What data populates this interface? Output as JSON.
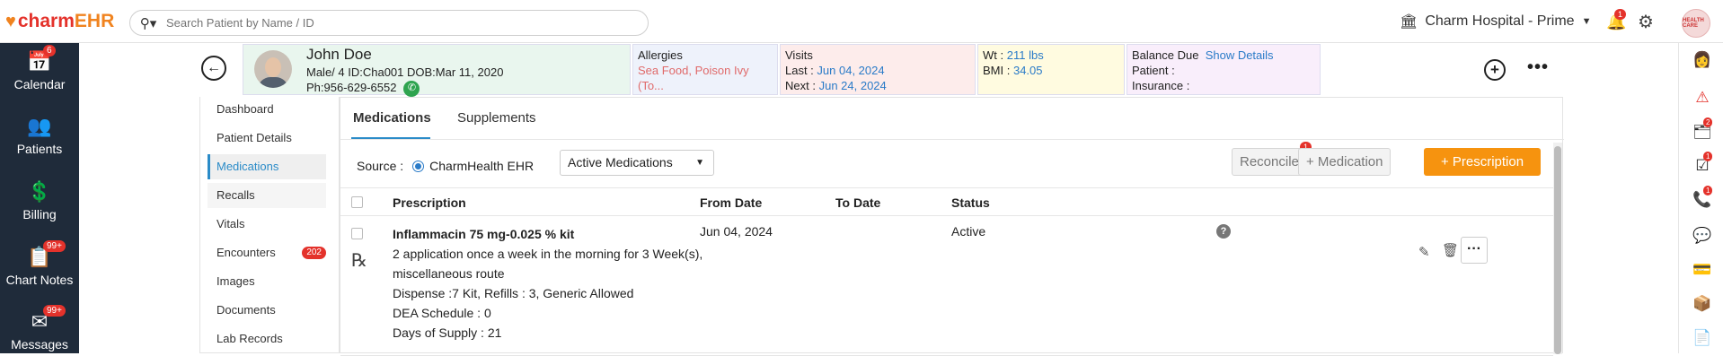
{
  "app": {
    "logo_charm": "charm",
    "logo_ehr": "EHR"
  },
  "search": {
    "placeholder": "Search Patient by Name / ID"
  },
  "header": {
    "hospital": "Charm Hospital - Prime",
    "bell_count": "1",
    "avatar_text": "HEALTH CARE"
  },
  "sidenav": [
    {
      "label": "Calendar",
      "badge": "6",
      "icon": "calendar-icon",
      "glyph": "📅"
    },
    {
      "label": "Patients",
      "badge": "",
      "icon": "patients-icon",
      "glyph": "👥"
    },
    {
      "label": "Billing",
      "badge": "",
      "icon": "billing-icon",
      "glyph": "💲"
    },
    {
      "label": "Chart Notes",
      "badge": "99+",
      "icon": "chart-notes-icon",
      "glyph": "📋"
    },
    {
      "label": "Messages",
      "badge": "99+",
      "icon": "messages-icon",
      "glyph": "✉"
    }
  ],
  "rightbar": [
    {
      "icon": "user-avatar-icon",
      "glyph": "👩",
      "badge": ""
    },
    {
      "icon": "alert-icon",
      "glyph": "⚠",
      "badge": ""
    },
    {
      "icon": "tasks-icon",
      "glyph": "🗂",
      "badge": "2"
    },
    {
      "icon": "checklist-icon",
      "glyph": "☑",
      "badge": "1"
    },
    {
      "icon": "phone-icon",
      "glyph": "📞",
      "badge": "1"
    },
    {
      "icon": "chat-icon",
      "glyph": "💬",
      "badge": ""
    },
    {
      "icon": "card-icon",
      "glyph": "💳",
      "badge": ""
    },
    {
      "icon": "package-icon",
      "glyph": "📦",
      "badge": ""
    },
    {
      "icon": "document-icon",
      "glyph": "📄",
      "badge": ""
    }
  ],
  "patient": {
    "name": "John Doe",
    "line1": "Male/ 4 ID:Cha001 DOB:Mar 11, 2020",
    "phone": "Ph:956-629-6552",
    "allergies_label": "Allergies",
    "allergies_value": "Sea Food, Poison Ivy (To...",
    "visits_label": "Visits",
    "last_label": "Last  :",
    "last_value": "Jun 04, 2024",
    "next_label": "Next :",
    "next_value": "Jun 24, 2024",
    "wt_label": "Wt   :",
    "wt_value": "211 lbs",
    "bmi_label": "BMI :",
    "bmi_value": "34.05",
    "balance_label": "Balance Due",
    "balance_link": "Show Details",
    "patient_label": "Patient :",
    "insurance_label": "Insurance :"
  },
  "leftmenu": [
    {
      "label": "Dashboard",
      "count": ""
    },
    {
      "label": "Patient Details",
      "count": ""
    },
    {
      "label": "Medications",
      "count": "",
      "active": true
    },
    {
      "label": "Recalls",
      "count": ""
    },
    {
      "label": "Vitals",
      "count": ""
    },
    {
      "label": "Encounters",
      "count": "202"
    },
    {
      "label": "Images",
      "count": ""
    },
    {
      "label": "Documents",
      "count": ""
    },
    {
      "label": "Lab Records",
      "count": ""
    }
  ],
  "tabs": {
    "medications": "Medications",
    "supplements": "Supplements"
  },
  "toolbar": {
    "source_label": "Source :",
    "source_value": "CharmHealth EHR",
    "filter": "Active Medications",
    "reconcile": "Reconcile",
    "reconcile_badge": "1",
    "add_medication": "+ Medication",
    "prescription": "+ Prescription"
  },
  "table": {
    "headers": {
      "prescription": "Prescription",
      "from": "From Date",
      "to": "To Date",
      "status": "Status"
    },
    "rows": [
      {
        "drug": "Inflammacin 75 mg-0.025 % kit",
        "line1": "2 application once a week in the morning for 3 Week(s),",
        "line2": "miscellaneous route",
        "line3": "Dispense :7 Kit, Refills : 3,  Generic Allowed",
        "line4": "DEA Schedule : 0",
        "line5": "Days of Supply : 21",
        "from": "Jun 04, 2024",
        "to": "",
        "status": "Active"
      }
    ]
  }
}
